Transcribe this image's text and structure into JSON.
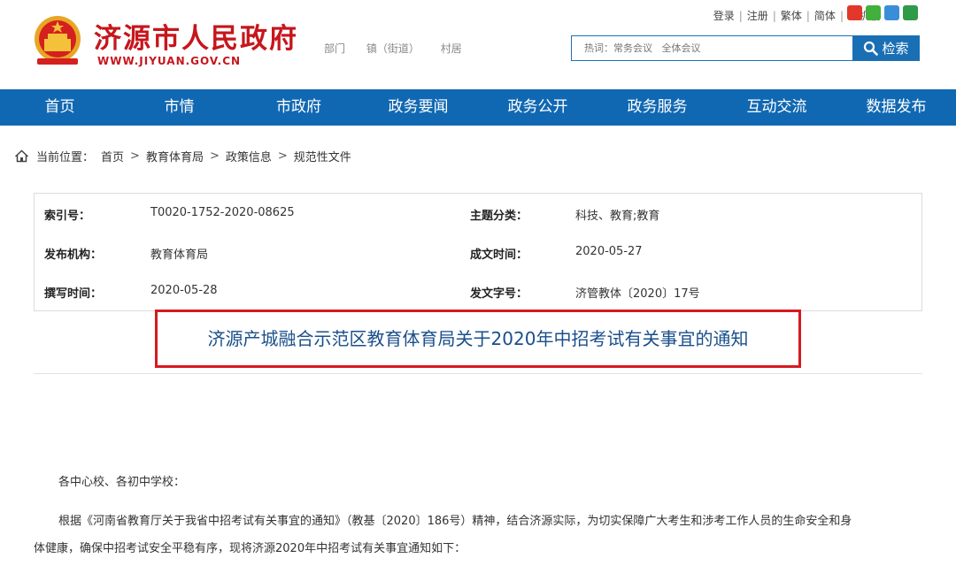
{
  "header": {
    "site_name": "济源市人民政府",
    "site_url": "WWW.JIYUAN.GOV.CN",
    "sub_links": [
      "部门",
      "镇（街道）",
      "村居"
    ],
    "top_links": [
      "登录",
      "注册",
      "繁体",
      "简体",
      "手机版"
    ],
    "social_icons": [
      {
        "name": "weibo-icon",
        "color": "#e2372a"
      },
      {
        "name": "wechat-icon",
        "color": "#42b03c"
      },
      {
        "name": "mobile-icon",
        "color": "#3a8ed8"
      },
      {
        "name": "accessibility-icon",
        "color": "#2e9a4a"
      }
    ],
    "search_placeholder": "热词：常务会议   全体会议",
    "search_button": "检索"
  },
  "nav": [
    "首页",
    "市情",
    "市政府",
    "政务要闻",
    "政务公开",
    "政务服务",
    "互动交流",
    "数据发布"
  ],
  "breadcrumb": {
    "label": "当前位置：",
    "items": [
      "首页",
      "教育体育局",
      "政策信息",
      "规范性文件"
    ]
  },
  "info": [
    {
      "label": "索引号：",
      "value": "T0020-1752-2020-08625"
    },
    {
      "label": "主题分类：",
      "value": "科技、教育;教育"
    },
    {
      "label": "发布机构：",
      "value": "教育体育局"
    },
    {
      "label": "成文时间：",
      "value": "2020-05-27"
    },
    {
      "label": "撰写时间：",
      "value": "2020-05-28"
    },
    {
      "label": "发文字号：",
      "value": "济管教体〔2020〕17号"
    }
  ],
  "title": "济源产城融合示范区教育体育局关于2020年中招考试有关事宜的通知",
  "body": {
    "greeting": "各中心校、各初中学校：",
    "para1_line1": "根据《河南省教育厅关于我省中招考试有关事宜的通知》（教基〔2020〕186号）精神，结合济源实际，为切实保障广大考生和涉考工作人员的生命安全和身",
    "para1_line2": "体健康，确保中招考试安全平稳有序，现将济源2020年中招考试有关事宜通知如下："
  },
  "colors": {
    "brand_red": "#c6161c",
    "nav_blue": "#1168b2",
    "title_blue": "#1a4f8b",
    "highlight_red": "#d71920"
  }
}
